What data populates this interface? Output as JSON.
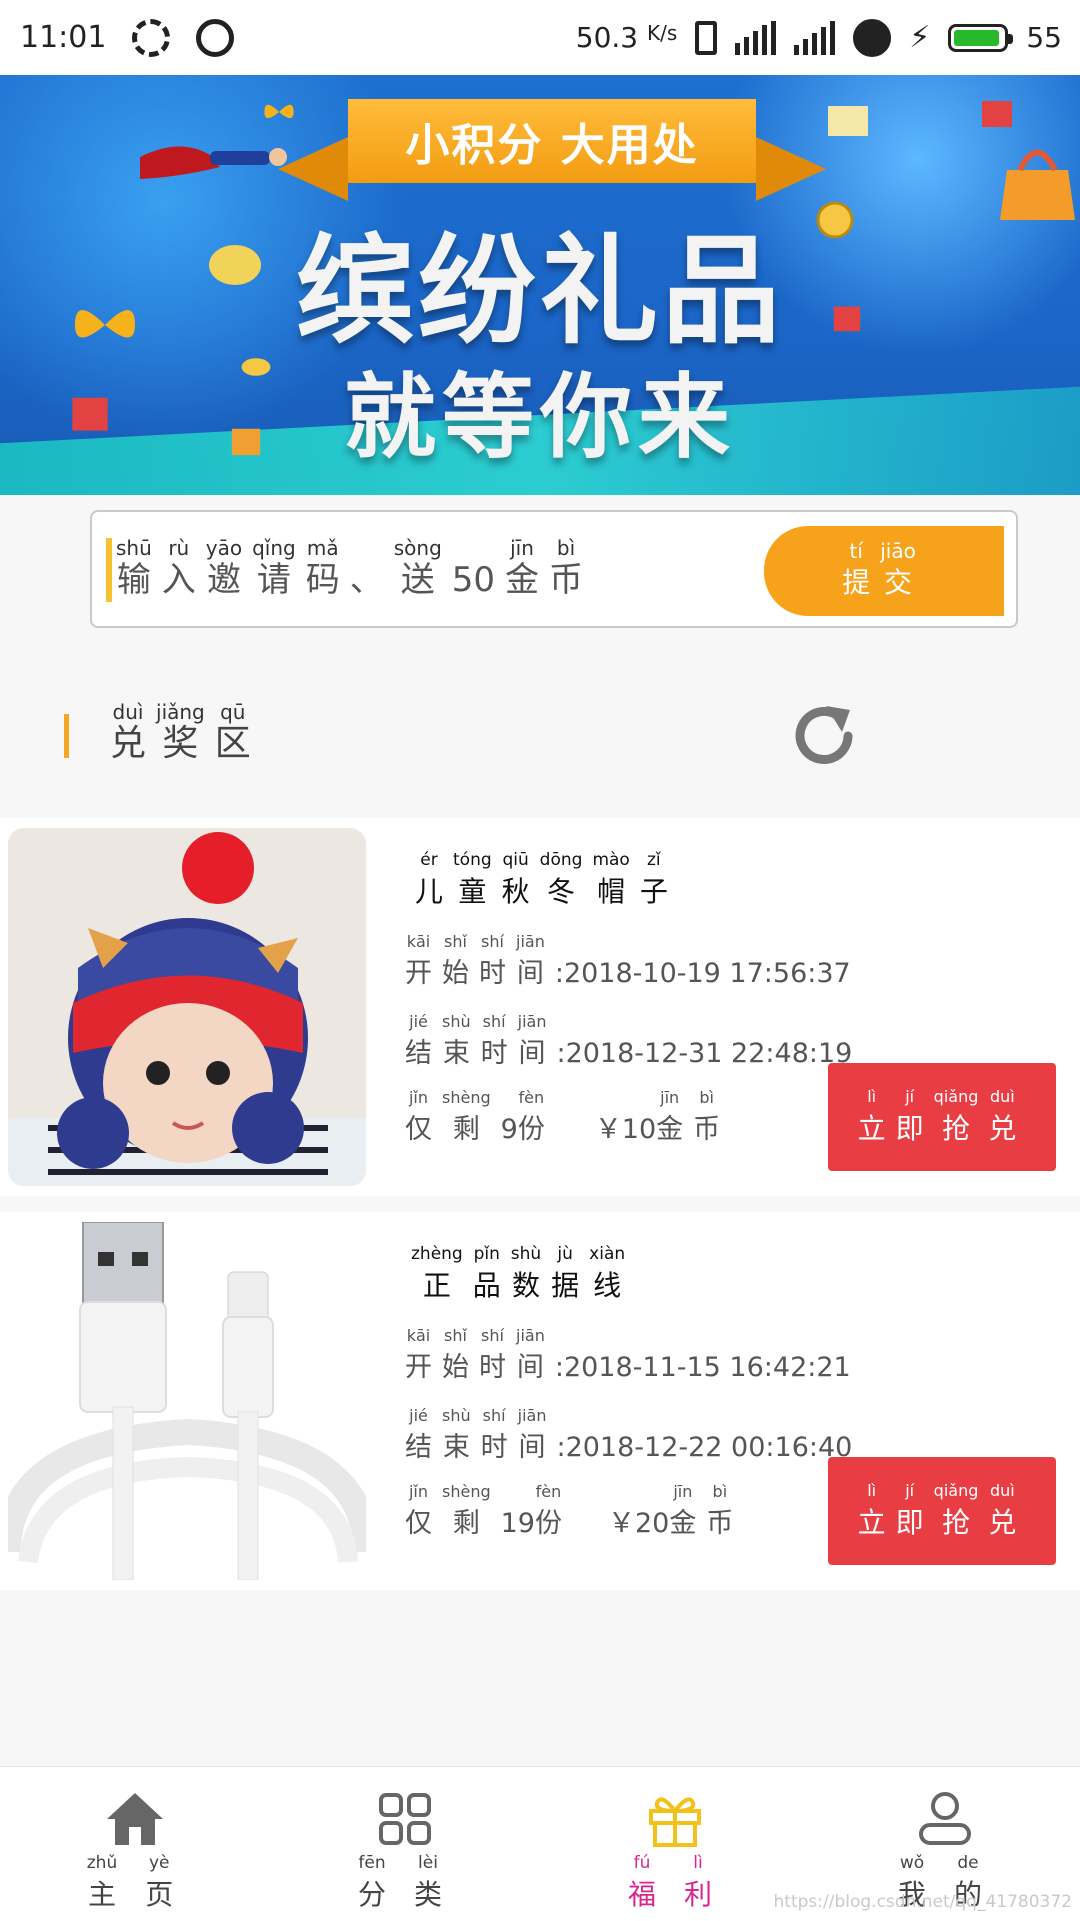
{
  "status_bar": {
    "time": "11:01",
    "speed": "50.3",
    "speed_unit": "K/s",
    "network": "4G",
    "battery": "55",
    "battery_level": 0.55
  },
  "banner": {
    "ribbon": "小积分 大用处",
    "line1": "缤纷礼品",
    "line2": "就等你来"
  },
  "invite": {
    "text": [
      {
        "py": "shū",
        "hz": "输"
      },
      {
        "py": "rù",
        "hz": "入"
      },
      {
        "py": "yāo",
        "hz": "邀"
      },
      {
        "py": "qǐng",
        "hz": "请"
      },
      {
        "py": "mǎ",
        "hz": "码"
      },
      {
        "py": "",
        "hz": "、"
      },
      {
        "py": "sòng",
        "hz": "送"
      },
      {
        "py": "",
        "hz": "50"
      },
      {
        "py": "jīn",
        "hz": "金"
      },
      {
        "py": "bì",
        "hz": "币"
      }
    ],
    "button": [
      {
        "py": "tí",
        "hz": "提"
      },
      {
        "py": "jiāo",
        "hz": "交"
      }
    ]
  },
  "section": {
    "title": [
      {
        "py": "duì",
        "hz": "兑"
      },
      {
        "py": "jiǎng",
        "hz": "奖"
      },
      {
        "py": "qū",
        "hz": "区"
      }
    ]
  },
  "labels": {
    "start": [
      {
        "py": "kāi",
        "hz": "开"
      },
      {
        "py": "shǐ",
        "hz": "始"
      },
      {
        "py": "shí",
        "hz": "时"
      },
      {
        "py": "jiān",
        "hz": "间"
      }
    ],
    "end": [
      {
        "py": "jié",
        "hz": "结"
      },
      {
        "py": "shù",
        "hz": "束"
      },
      {
        "py": "shí",
        "hz": "时"
      },
      {
        "py": "jiān",
        "hz": "间"
      }
    ],
    "remain_prefix": {
      "py": "jǐn",
      "hz": "仅"
    },
    "remain_mid": {
      "py": "shèng",
      "hz": "剩"
    },
    "remain_suffix": {
      "py": "fèn",
      "hz": "份"
    },
    "coin": [
      {
        "py": "jīn",
        "hz": "金"
      },
      {
        "py": "bì",
        "hz": "币"
      }
    ],
    "buy": [
      {
        "py": "lì",
        "hz": "立"
      },
      {
        "py": "jí",
        "hz": "即"
      },
      {
        "py": "qiǎng",
        "hz": "抢"
      },
      {
        "py": "duì",
        "hz": "兑"
      }
    ]
  },
  "products": [
    {
      "name": [
        {
          "py": "ér",
          "hz": "儿"
        },
        {
          "py": "tóng",
          "hz": "童"
        },
        {
          "py": "qiū",
          "hz": "秋"
        },
        {
          "py": "dōng",
          "hz": "冬"
        },
        {
          "py": "mào",
          "hz": "帽"
        },
        {
          "py": "zǐ",
          "hz": "子"
        }
      ],
      "start_time": ":2018-10-19 17:56:37",
      "end_time": ":2018-12-31 22:48:19",
      "remaining": "9",
      "price": "￥10"
    },
    {
      "name": [
        {
          "py": "zhèng",
          "hz": "正"
        },
        {
          "py": "pǐn",
          "hz": "品"
        },
        {
          "py": "shù",
          "hz": "数"
        },
        {
          "py": "jù",
          "hz": "据"
        },
        {
          "py": "xiàn",
          "hz": "线"
        }
      ],
      "start_time": ":2018-11-15 16:42:21",
      "end_time": ":2018-12-22 00:16:40",
      "remaining": "19",
      "price": "￥20"
    }
  ],
  "nav": [
    {
      "icon": "home-icon",
      "label": [
        {
          "py": "zhǔ",
          "hz": "主"
        },
        {
          "py": "yè",
          "hz": "页"
        }
      ],
      "active": false
    },
    {
      "icon": "grid-icon",
      "label": [
        {
          "py": "fēn",
          "hz": "分"
        },
        {
          "py": "lèi",
          "hz": "类"
        }
      ],
      "active": false
    },
    {
      "icon": "gift-icon",
      "label": [
        {
          "py": "fú",
          "hz": "福"
        },
        {
          "py": "lì",
          "hz": "利"
        }
      ],
      "active": true,
      "active_color": "#d9268f"
    },
    {
      "icon": "user-icon",
      "label": [
        {
          "py": "wǒ",
          "hz": "我"
        },
        {
          "py": "de",
          "hz": "的"
        }
      ],
      "active": false
    }
  ],
  "watermark": "https://blog.csdn.net/qq_41780372"
}
